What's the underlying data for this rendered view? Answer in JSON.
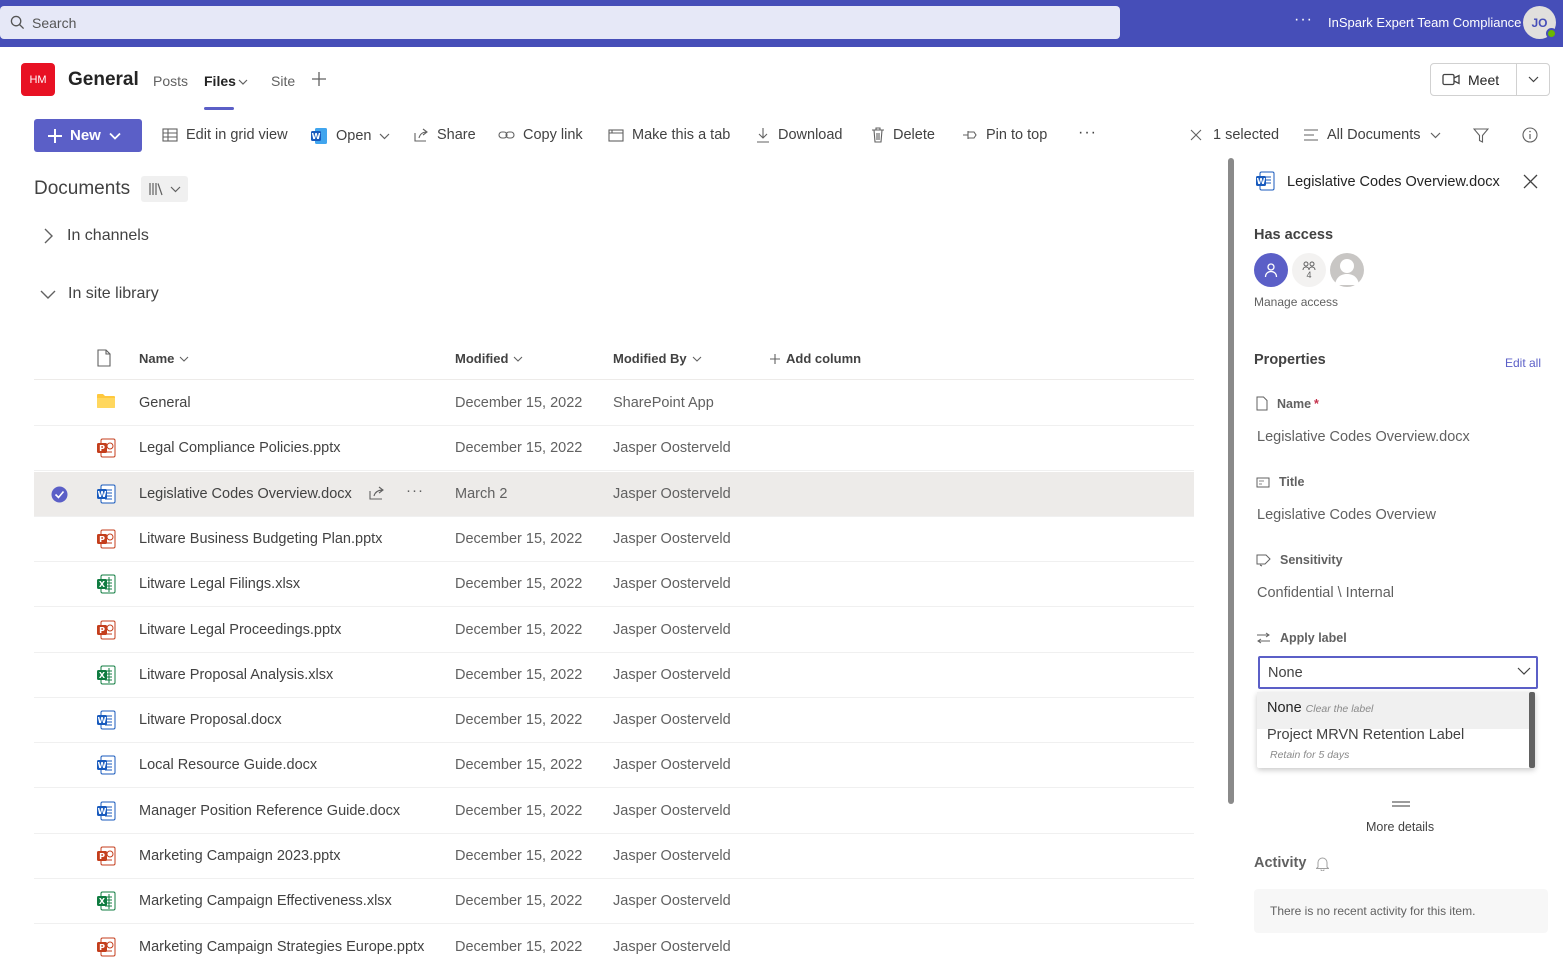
{
  "topbar": {
    "search_placeholder": "Search",
    "more": "···",
    "org_name": "InSpark Expert Team Compliance",
    "avatar_initials": "JO",
    "status_color": "#6bb700"
  },
  "channel": {
    "team_initials": "HM",
    "title": "General",
    "tabs": [
      "Posts",
      "Files",
      "Site"
    ],
    "active_tab": "Files",
    "meet_label": "Meet"
  },
  "toolbar": {
    "new_label": "New",
    "edit_grid": "Edit in grid view",
    "open": "Open",
    "share": "Share",
    "copy_link": "Copy link",
    "make_tab": "Make this a tab",
    "download": "Download",
    "delete": "Delete",
    "pin": "Pin to top",
    "more": "···",
    "selected": "1 selected",
    "view": "All Documents"
  },
  "library": {
    "title": "Documents",
    "sections": [
      "In channels",
      "In site library"
    ],
    "columns": {
      "name": "Name",
      "modified": "Modified",
      "modified_by": "Modified By",
      "add_column": "Add column"
    },
    "rows": [
      {
        "type": "folder",
        "name": "General",
        "modified": "December 15, 2022",
        "modified_by": "SharePoint App"
      },
      {
        "type": "pptx",
        "name": "Legal Compliance Policies.pptx",
        "modified": "December 15, 2022",
        "modified_by": "Jasper Oosterveld"
      },
      {
        "type": "docx",
        "name": "Legislative Codes Overview.docx",
        "modified": "March 2",
        "modified_by": "Jasper Oosterveld",
        "selected": true
      },
      {
        "type": "pptx",
        "name": "Litware Business Budgeting Plan.pptx",
        "modified": "December 15, 2022",
        "modified_by": "Jasper Oosterveld"
      },
      {
        "type": "xlsx",
        "name": "Litware Legal Filings.xlsx",
        "modified": "December 15, 2022",
        "modified_by": "Jasper Oosterveld"
      },
      {
        "type": "pptx",
        "name": "Litware Legal Proceedings.pptx",
        "modified": "December 15, 2022",
        "modified_by": "Jasper Oosterveld"
      },
      {
        "type": "xlsx",
        "name": "Litware Proposal Analysis.xlsx",
        "modified": "December 15, 2022",
        "modified_by": "Jasper Oosterveld"
      },
      {
        "type": "docx",
        "name": "Litware Proposal.docx",
        "modified": "December 15, 2022",
        "modified_by": "Jasper Oosterveld"
      },
      {
        "type": "docx",
        "name": "Local Resource Guide.docx",
        "modified": "December 15, 2022",
        "modified_by": "Jasper Oosterveld"
      },
      {
        "type": "docx",
        "name": "Manager Position Reference Guide.docx",
        "modified": "December 15, 2022",
        "modified_by": "Jasper Oosterveld"
      },
      {
        "type": "pptx",
        "name": "Marketing Campaign 2023.pptx",
        "modified": "December 15, 2022",
        "modified_by": "Jasper Oosterveld"
      },
      {
        "type": "xlsx",
        "name": "Marketing Campaign Effectiveness.xlsx",
        "modified": "December 15, 2022",
        "modified_by": "Jasper Oosterveld"
      },
      {
        "type": "pptx",
        "name": "Marketing Campaign Strategies Europe.pptx",
        "modified": "December 15, 2022",
        "modified_by": "Jasper Oosterveld"
      }
    ]
  },
  "panel": {
    "file_name": "Legislative Codes Overview.docx",
    "has_access": "Has access",
    "access_count": "4",
    "manage_access": "Manage access",
    "properties": "Properties",
    "edit_all": "Edit all",
    "name_label": "Name",
    "required_mark": "*",
    "name_value": "Legislative Codes Overview.docx",
    "title_label": "Title",
    "title_value": "Legislative Codes Overview",
    "sensitivity_label": "Sensitivity",
    "sensitivity_value": "Confidential \\ Internal",
    "apply_label": "Apply label",
    "apply_value": "None",
    "options": [
      {
        "label": "None",
        "hint": "Clear the label"
      },
      {
        "label": "Project MRVN Retention Label",
        "hint": "Retain for 5 days"
      }
    ],
    "more_details": "More details",
    "activity": "Activity",
    "activity_empty": "There is no recent activity for this item."
  },
  "colors": {
    "brand": "#5b5fc7",
    "topbar": "#464eb8",
    "team_logo": "#e81123",
    "word": "#185abd",
    "excel": "#107c41",
    "powerpoint": "#c43e1c",
    "folder": "#ffc83d"
  }
}
